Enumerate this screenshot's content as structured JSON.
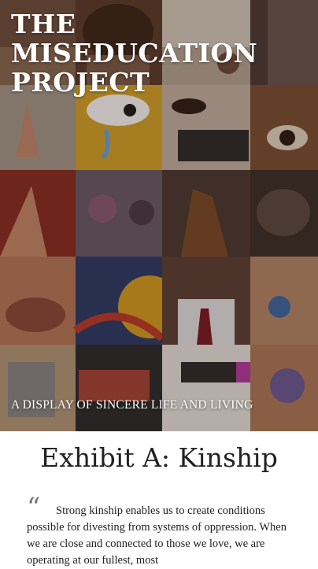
{
  "hero": {
    "title_lines": [
      "THE",
      "MISEDUCATION",
      "PROJECT"
    ],
    "subtitle": "A DISPLAY OF SINCERE LIFE AND LIVING"
  },
  "exhibit": {
    "title": "Exhibit A: Kinship",
    "quote_icon": "quote-icon",
    "quote": "Strong kinship enables us to create conditions possible for divesting from systems of oppression. When we are close and connected to those we love, we are operating at our fullest, most"
  },
  "colors": {
    "text_dark": "#222222",
    "quote_mark": "#777777",
    "hero_text": "#ffffff"
  }
}
